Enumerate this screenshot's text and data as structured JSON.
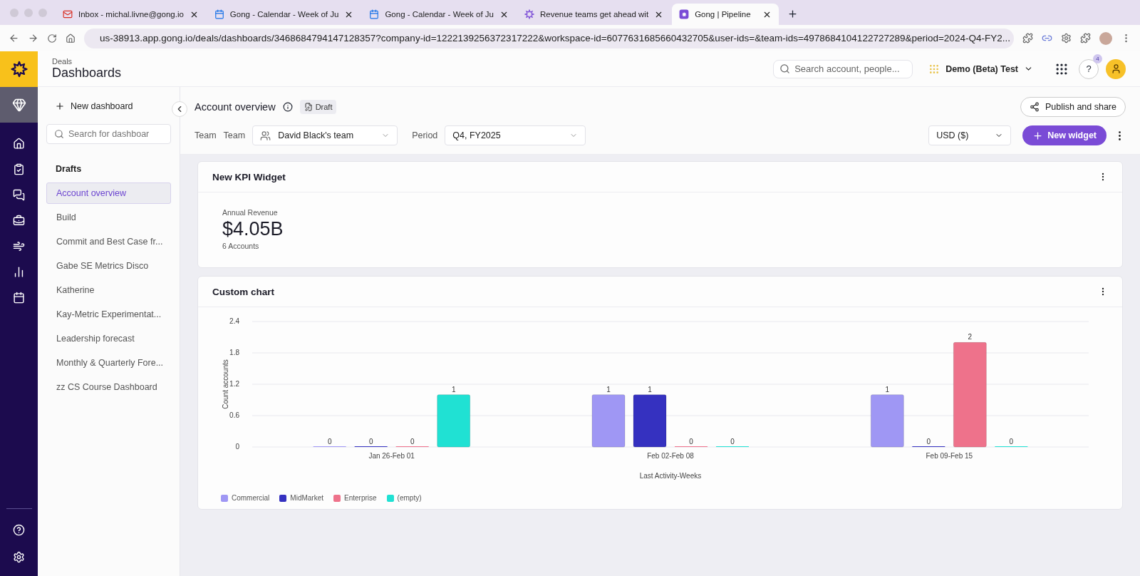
{
  "browser": {
    "tabs": [
      {
        "kind": "mail",
        "title": "Inbox - michal.livne@gong.io",
        "selected": false
      },
      {
        "kind": "calendar",
        "title": "Gong - Calendar - Week of Ju",
        "selected": false
      },
      {
        "kind": "calendar",
        "title": "Gong - Calendar - Week of Ju",
        "selected": false
      },
      {
        "kind": "star",
        "title": "Revenue teams get ahead wit",
        "selected": false
      },
      {
        "kind": "app",
        "title": "Gong | Pipeline",
        "selected": true
      }
    ],
    "url": "us-38913.app.gong.io/deals/dashboards/3468684794147128357?company-id=1222139256372317222&workspace-id=6077631685660432705&user-ids=&team-ids=4978684104122727289&period=2024-Q4-FY2..."
  },
  "header": {
    "breadcrumb": "Deals",
    "title": "Dashboards",
    "search": {
      "placeholder": "Search account, people..."
    },
    "workspace": "Demo (Beta) Test",
    "help_badge": "4",
    "help": "?"
  },
  "rail": {
    "items": [
      {
        "kind": "home",
        "selected": false
      },
      {
        "kind": "tasks",
        "selected": false
      },
      {
        "kind": "chat",
        "selected": false
      },
      {
        "kind": "deals",
        "selected": false
      },
      {
        "kind": "coach",
        "selected": false
      },
      {
        "kind": "analytics",
        "selected": false
      },
      {
        "kind": "calendar",
        "selected": false
      }
    ]
  },
  "sidebar": {
    "new_button": "New dashboard",
    "search": {
      "placeholder": "Search for dashboar"
    },
    "section": "Drafts",
    "items": [
      {
        "label": "Account overview",
        "selected": true
      },
      {
        "label": "Build",
        "selected": false
      },
      {
        "label": "Commit and Best Case fr...",
        "selected": false
      },
      {
        "label": "Gabe SE Metrics Disco",
        "selected": false
      },
      {
        "label": "Katherine",
        "selected": false
      },
      {
        "label": "Kay-Metric Experimentat...",
        "selected": false
      },
      {
        "label": "Leadership forecast",
        "selected": false
      },
      {
        "label": "Monthly & Quarterly Fore...",
        "selected": false
      },
      {
        "label": "zz CS Course Dashboard",
        "selected": false
      }
    ]
  },
  "dashboard": {
    "title": "Account overview",
    "status": "Draft",
    "publish": "Publish and share",
    "filters": [
      {
        "kind": "team",
        "label": "Team",
        "sublabel": "Team",
        "value": "David Black's team"
      },
      {
        "kind": "period",
        "label": "Period",
        "value": "Q4, FY2025"
      }
    ],
    "currency": "USD ($)",
    "new_widget": "New widget",
    "kpi": {
      "title": "New KPI Widget",
      "label": "Annual Revenue",
      "value": "$4.05B",
      "caption": "6 Accounts"
    },
    "chart": {
      "title": "Custom chart",
      "chart_data": {
        "type": "bar",
        "xlabel": "Last Activity-Weeks",
        "ylabel": "Count accounts",
        "categories": [
          "Jan 26-Feb 01",
          "Feb 02-Feb 08",
          "Feb 09-Feb 15"
        ],
        "series": [
          {
            "name": "Commercial",
            "color": "#9f97f4",
            "values": [
              0,
              1,
              1
            ]
          },
          {
            "name": "MidMarket",
            "color": "#3531c0",
            "values": [
              0,
              1,
              0
            ]
          },
          {
            "name": "Enterprise",
            "color": "#ee728b",
            "values": [
              0,
              0,
              2
            ]
          },
          {
            "name": "(empty)",
            "color": "#20e1d3",
            "values": [
              1,
              0,
              0
            ]
          }
        ],
        "ylim": [
          0,
          2.4
        ],
        "grid": true,
        "yticks": [
          0,
          0.6,
          1.2,
          1.8,
          2.4
        ],
        "data_labels": true
      }
    }
  }
}
